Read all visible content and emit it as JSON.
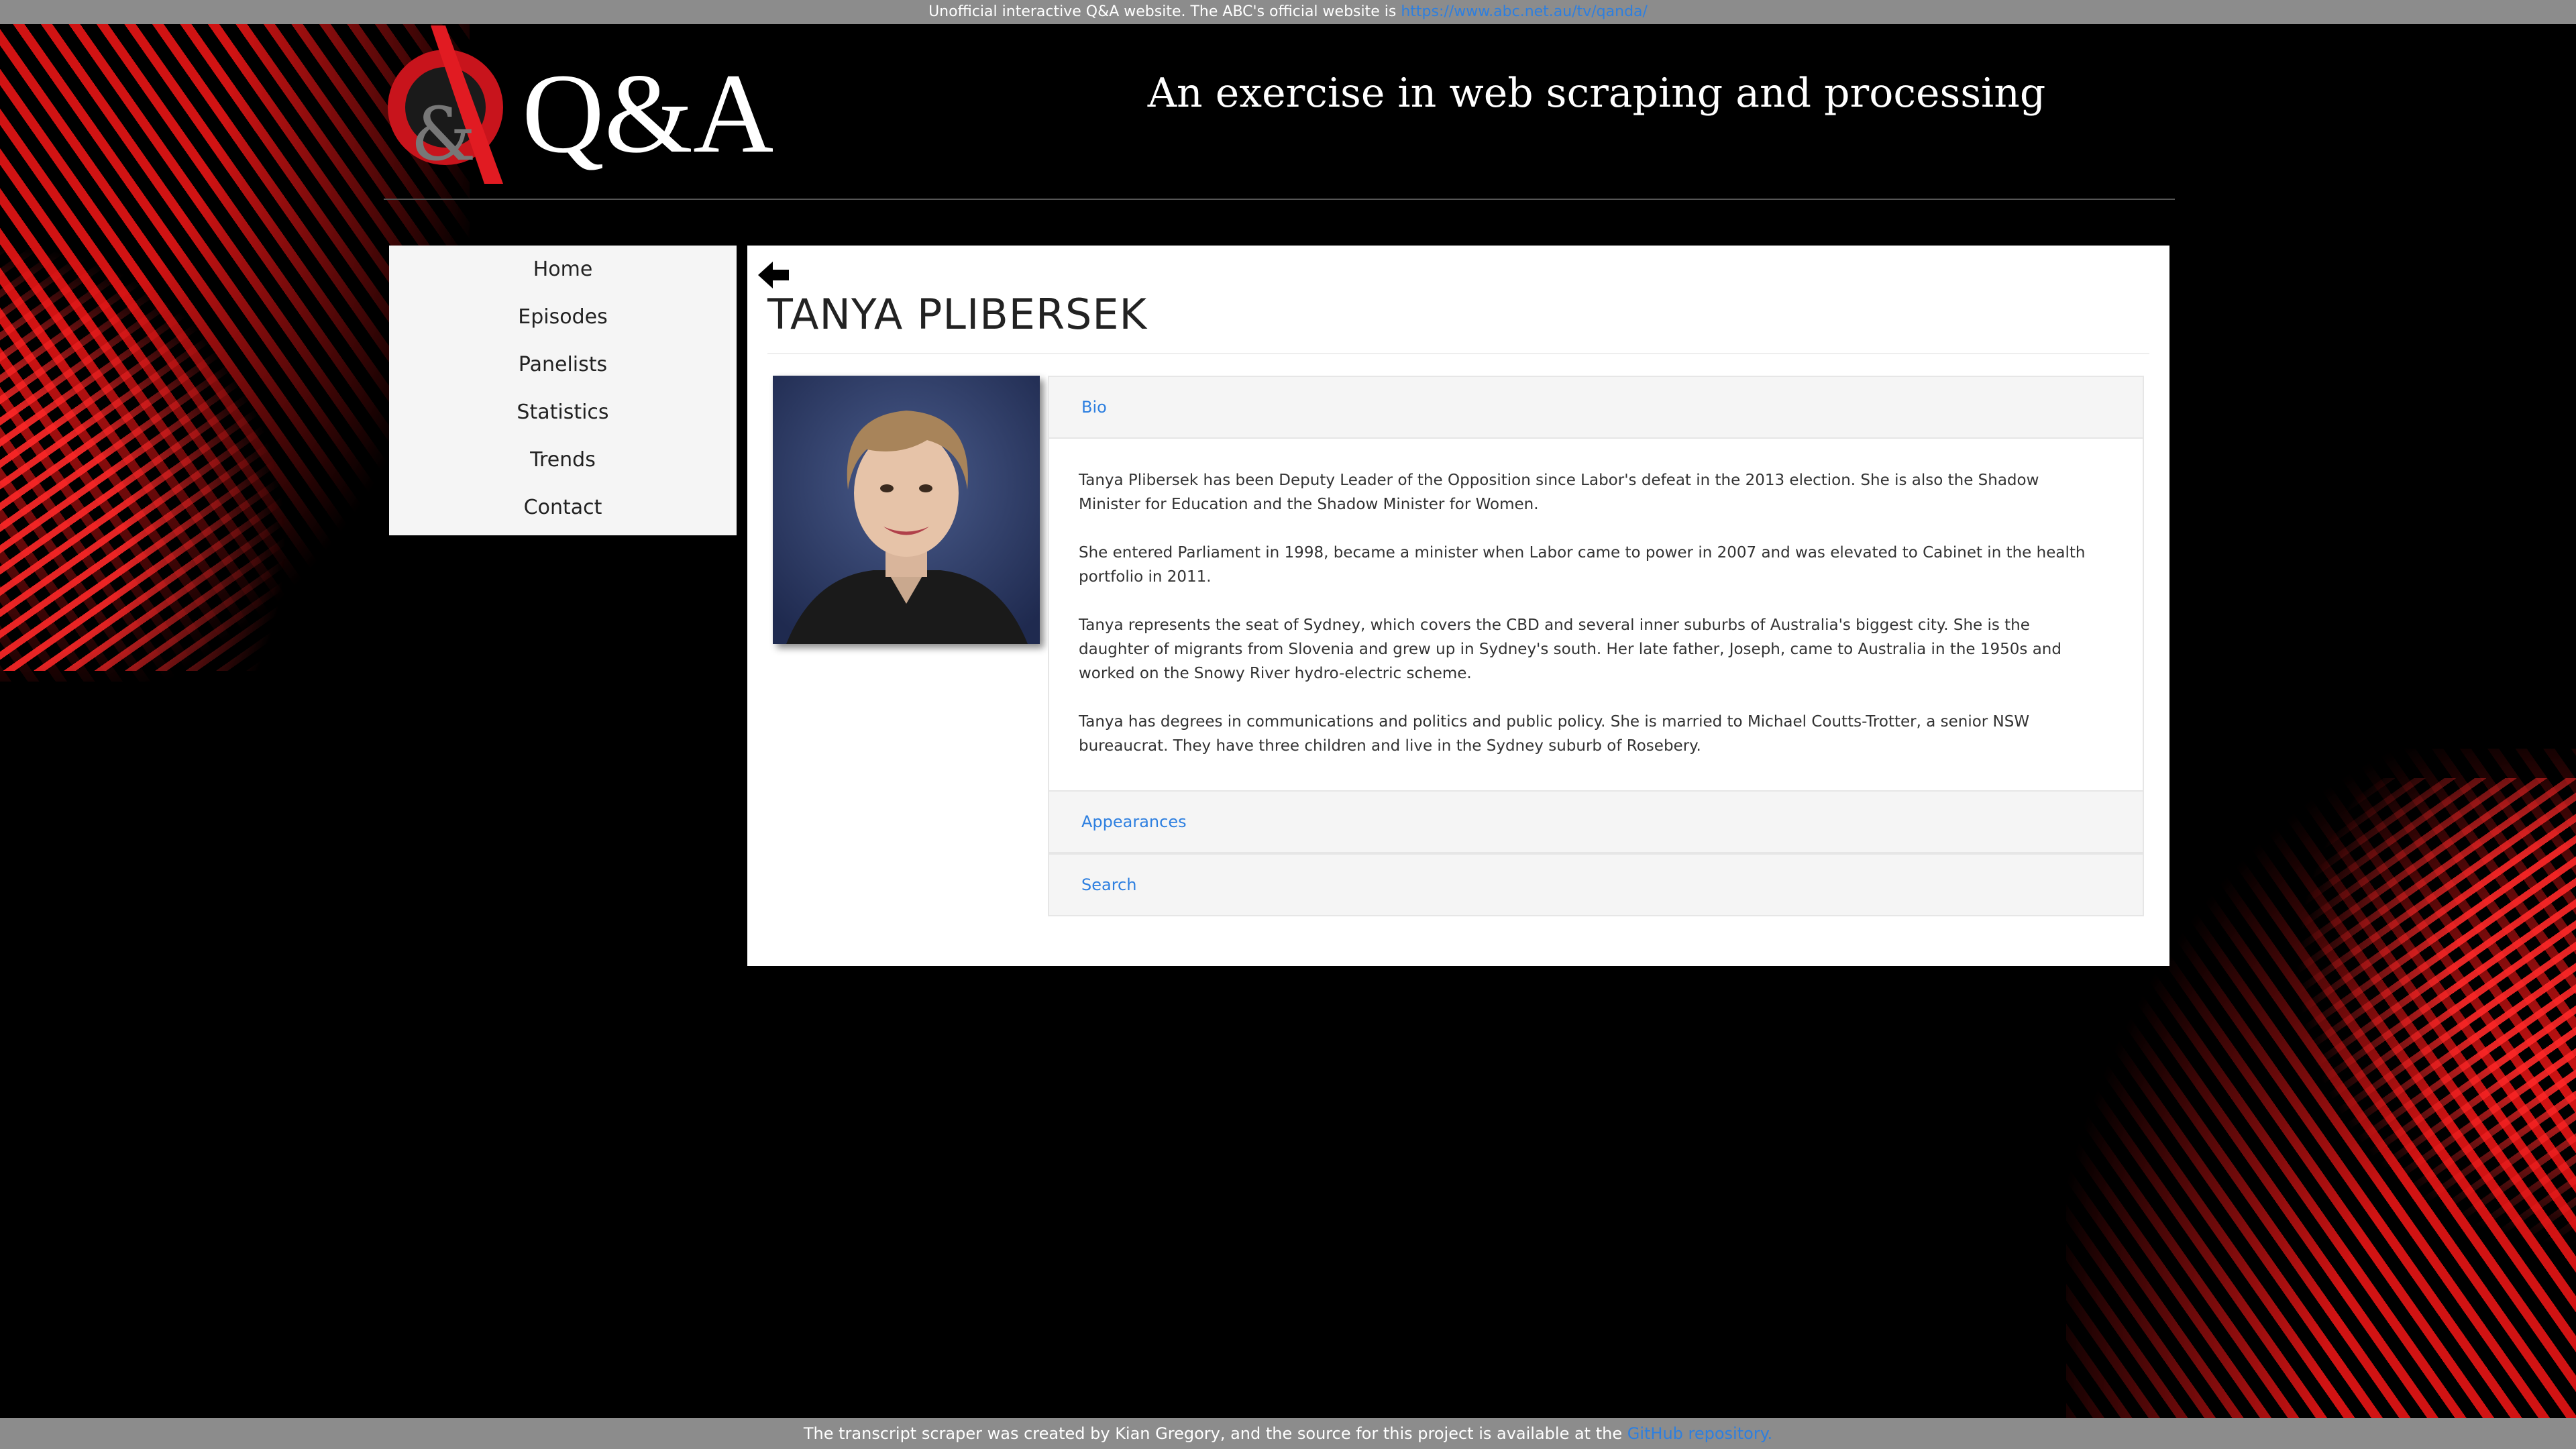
{
  "top_notice": {
    "text": "Unofficial interactive Q&A website. The ABC's official website is",
    "link_text": "https://www.abc.net.au/tv/qanda/"
  },
  "header": {
    "logo_text": "Q&A",
    "logo_badge_text": "&",
    "tagline": "An exercise in web scraping and processing"
  },
  "nav": {
    "items": [
      {
        "label": "Home"
      },
      {
        "label": "Episodes"
      },
      {
        "label": "Panelists"
      },
      {
        "label": "Statistics"
      },
      {
        "label": "Trends"
      },
      {
        "label": "Contact"
      }
    ]
  },
  "main": {
    "title": "TANYA PLIBERSEK",
    "accordion": {
      "bio_label": "Bio",
      "bio_paragraphs": [
        "Tanya Plibersek has been Deputy Leader of the Opposition since Labor's defeat in the 2013 election. She is also the Shadow Minister for Education and the Shadow Minister for Women.",
        "She entered Parliament in 1998, became a minister when Labor came to power in 2007 and was elevated to Cabinet in the health portfolio in 2011.",
        "Tanya represents the seat of Sydney, which covers the CBD and several inner suburbs of Australia's biggest city. She is the daughter of migrants from Slovenia and grew up in Sydney's south. Her late father, Joseph, came to Australia in the 1950s and worked on the Snowy River hydro-electric scheme.",
        "Tanya has degrees in communications and politics and public policy. She is married to Michael Coutts-Trotter, a senior NSW bureaucrat. They have three children and live in the Sydney suburb of Rosebery."
      ],
      "appearances_label": "Appearances",
      "search_label": "Search"
    }
  },
  "footer": {
    "text": "The transcript scraper was created by Kian Gregory, and the source for this project is available at the",
    "link_text": "GitHub repository."
  },
  "colors": {
    "accent_red": "#d41414",
    "link_blue": "#2d7fe0",
    "bar_grey": "#8c8c8c"
  }
}
